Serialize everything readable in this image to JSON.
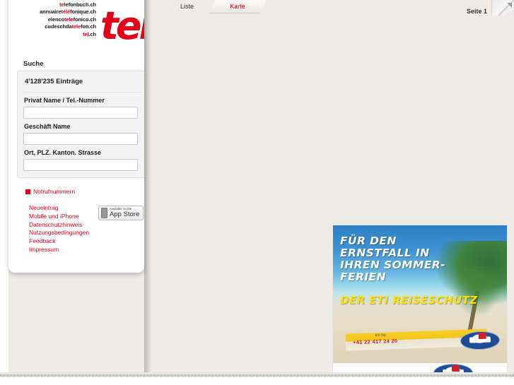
{
  "brand": {
    "domains": [
      {
        "pre": "",
        "red": "tel",
        "post": "efonbuch.ch"
      },
      {
        "pre": "annuaire",
        "red": "télé",
        "post": "fonique.ch"
      },
      {
        "pre": "elenco",
        "red": "tele",
        "post": "fonico.ch"
      },
      {
        "pre": "cudeschda",
        "red": "tele",
        "post": "fon.ch"
      },
      {
        "pre": "",
        "red": "tel",
        "post": ".ch"
      }
    ],
    "logo_text": "tel",
    "logo_color": "#e2001a"
  },
  "sidebar": {
    "search_title": "Suche",
    "entry_count": "4'128'235 Einträge",
    "fields": [
      {
        "label": "Privat Name / Tel.-Nummer",
        "value": "",
        "placeholder": ""
      },
      {
        "label": "Geschäft Name",
        "value": "",
        "placeholder": ""
      },
      {
        "label": "Ort, PLZ. Kanton. Strasse",
        "value": "",
        "placeholder": ""
      }
    ],
    "emergency_link": "Notrufnummern",
    "footer_links": [
      "Neueintrag",
      "Mobile und iPhone",
      "Datenschutzhinweis",
      "Nutzungsbedingungen",
      "Feedback",
      "Impressum"
    ],
    "appstore": {
      "small_text": "Available on the",
      "big_text": "App Store"
    }
  },
  "topbar": {
    "tabs": [
      {
        "label": "Liste",
        "active": false
      },
      {
        "label": "Karte",
        "active": true
      }
    ],
    "page_indicator": "Seite 1",
    "expand_icon": "resize-expand-icon"
  },
  "advert": {
    "headline": "FÜR DEN ERNSTFALL IN IHREN SOMMER-FERIEN",
    "subline": "DER ETI REISESCHUTZ",
    "bar_label": "ETI Tel.",
    "bar_phone": "+41 22 417 24 20",
    "logo": "tcs-shield-logo"
  },
  "colors": {
    "accent_red": "#e2001a",
    "page_bg": "#efece6",
    "ad_yellow": "#ffe000"
  }
}
